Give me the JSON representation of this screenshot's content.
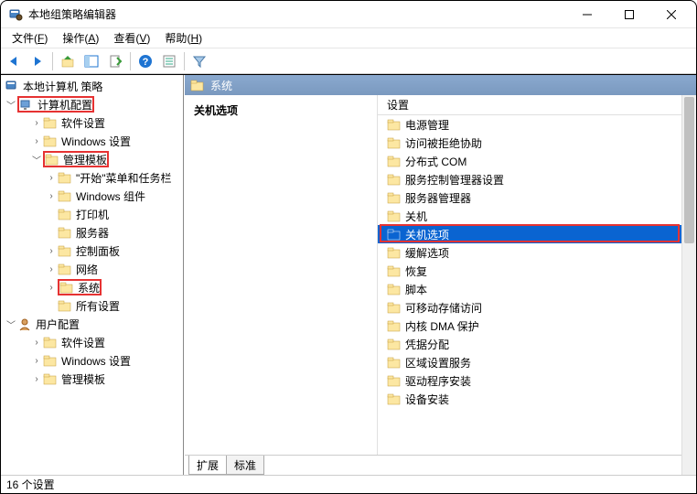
{
  "window": {
    "title": "本地组策略编辑器"
  },
  "menu": {
    "file": {
      "label": "文件",
      "hotkey": "F"
    },
    "action": {
      "label": "操作",
      "hotkey": "A"
    },
    "view": {
      "label": "查看",
      "hotkey": "V"
    },
    "help": {
      "label": "帮助",
      "hotkey": "H"
    }
  },
  "tree": {
    "root": "本地计算机 策略",
    "computer_config": "计算机配置",
    "software_settings": "软件设置",
    "windows_settings": "Windows 设置",
    "admin_templates": "管理模板",
    "start_menu_taskbar": "\"开始\"菜单和任务栏",
    "windows_components": "Windows 组件",
    "printers": "打印机",
    "servers": "服务器",
    "control_panel": "控制面板",
    "network": "网络",
    "system": "系统",
    "all_settings": "所有设置",
    "user_config": "用户配置",
    "u_software": "软件设置",
    "u_windows": "Windows 设置",
    "u_admin": "管理模板"
  },
  "main": {
    "header": "系统",
    "detail_title": "关机选项",
    "column": "设置",
    "items": [
      "电源管理",
      "访问被拒绝协助",
      "分布式 COM",
      "服务控制管理器设置",
      "服务器管理器",
      "关机",
      "关机选项",
      "缓解选项",
      "恢复",
      "脚本",
      "可移动存储访问",
      "内核 DMA 保护",
      "凭据分配",
      "区域设置服务",
      "驱动程序安装",
      "设备安装"
    ],
    "selected_index": 6
  },
  "tabs": {
    "extended": "扩展",
    "standard": "标准"
  },
  "status": "16 个设置"
}
